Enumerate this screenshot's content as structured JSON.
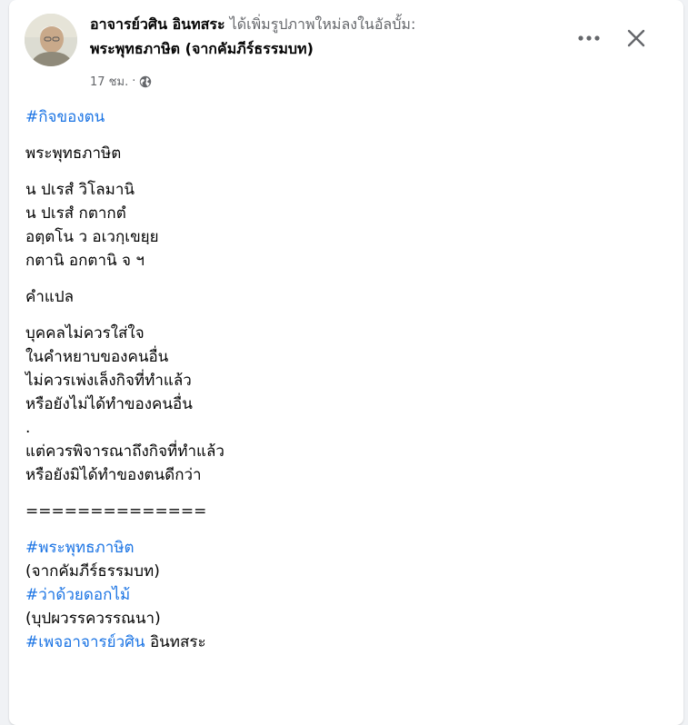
{
  "header": {
    "author": "อาจารย์วศิน อินทสระ",
    "action": "ได้เพิ่มรูปภาพใหม่ลงในอัลบั้ม:",
    "album": "พระพุทธภาษิต (จากคัมภีร์ธรรมบท)",
    "time": "17 ชม.",
    "separator": "·",
    "privacy_icon": "globe-icon",
    "more_icon": "more-horizontal-icon",
    "close_icon": "close-icon"
  },
  "post": {
    "tag_top": "#กิจของตน",
    "title": "พระพุทธภาษิต",
    "pali": [
      "น  ปเรสํ  วิโลมานิ",
      "น ปเรสํ  กตากตํ",
      "อตฺตโน  ว  อเวกฺเขยฺย",
      "กตานิ  อกตานิ  จ ฯ"
    ],
    "translation_heading": "คำแปล",
    "translation": [
      "บุคคลไม่ควรใส่ใจ",
      "ในคำหยาบของคนอื่น",
      "ไม่ควรเพ่งเล็งกิจที่ทำแล้ว",
      "หรือยังไม่ได้ทำของคนอื่น",
      ".",
      "แต่ควรพิจารณาถึงกิจที่ทำแล้ว",
      "หรือยังมิได้ทำของตนดีกว่า"
    ],
    "divider": "==============",
    "tag_1": "#พระพุทธภาษิต",
    "note_1": "(จากคัมภีร์ธรรมบท)",
    "tag_2": "#ว่าด้วยดอกไม้",
    "note_2": "(บุปผวรรควรรณนา)",
    "tag_3": "#เพจอาจารย์วศิน",
    "tag_3_suffix": " อินทสระ"
  },
  "colors": {
    "hashtag": "#1b74e4",
    "secondary_text": "#65676b",
    "primary_text": "#050505"
  }
}
